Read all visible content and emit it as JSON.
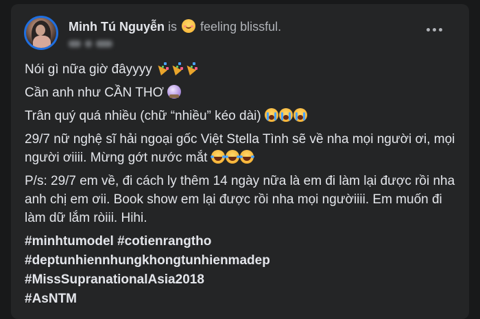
{
  "post": {
    "author": "Minh Tú Nguyễn",
    "is_text": "is",
    "feeling_icon": "smiling-face-icon",
    "feeling_text": "feeling blissful.",
    "more_icon": "more-options-icon",
    "lines": {
      "l1": "Nói gì nữa giờ đâyyyy",
      "l2": "Cần anh như CẦN THƠ",
      "l3": "Trân quý quá nhiều (chữ “nhiều” kéo dài)",
      "l4": "29/7 nữ nghệ sĩ hải ngoại gốc Việt Stella Tình sẽ về nha mọi người ơi, mọi người ơiiii. Mừng gớt nước mắt",
      "l5": "P/s: 29/7 em về, đi cách ly thêm 14 ngày nữa là em đi làm lại được rồi nha anh chị em ơii. Book show em lại được rồi nha mọi ngườiiii. Em muốn đi làm dữ lắm ròiii.  Hihi."
    },
    "hashtags": [
      "#minhtumodel #cotienrangtho",
      "#deptunhiennhungkhongtunhienmadep",
      "#MissSupranationalAsia2018",
      "#AsNTM"
    ]
  },
  "colors": {
    "background": "#18191a",
    "card": "#242526",
    "text_primary": "#e4e6eb",
    "text_secondary": "#b0b3b8",
    "avatar_ring": "#1f6fe0"
  }
}
